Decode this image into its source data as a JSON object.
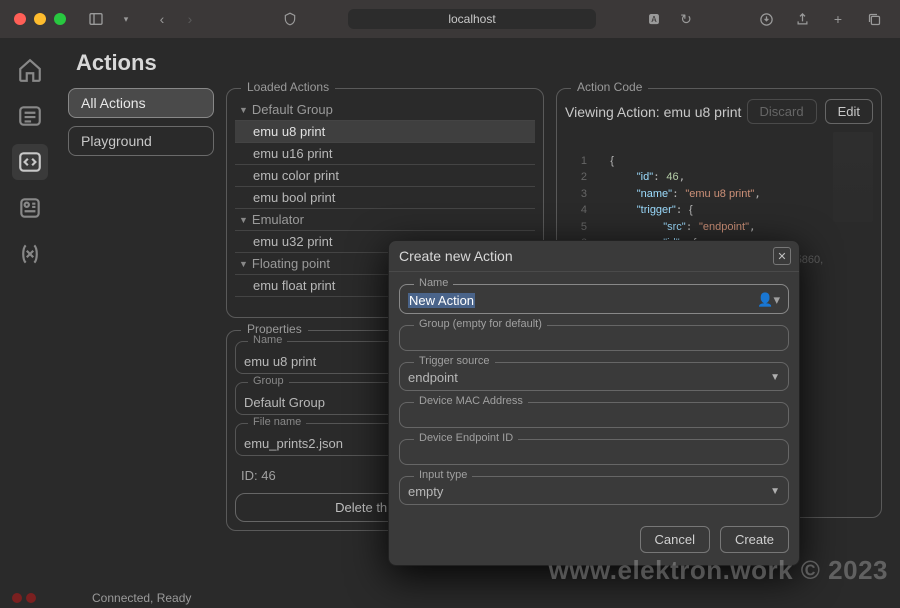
{
  "titlebar": {
    "address": "localhost"
  },
  "page": {
    "title": "Actions"
  },
  "sidebar_pills": {
    "all_actions": "All Actions",
    "playground": "Playground"
  },
  "loaded_actions": {
    "legend": "Loaded Actions",
    "groups": [
      {
        "name": "Default Group",
        "items": [
          "emu u8 print",
          "emu u16 print",
          "emu color print",
          "emu bool print"
        ]
      },
      {
        "name": "Emulator",
        "items": [
          "emu u32 print"
        ]
      },
      {
        "name": "Floating point",
        "items": [
          "emu float print"
        ]
      }
    ],
    "selected": "emu u8 print"
  },
  "properties": {
    "legend": "Properties",
    "name": {
      "label": "Name",
      "value": "emu u8 print"
    },
    "group": {
      "label": "Group",
      "value": "Default Group"
    },
    "file": {
      "label": "File name",
      "value": "emu_prints2.json"
    },
    "id_line": "ID: 46",
    "delete_label": "Delete this action"
  },
  "action_code": {
    "legend": "Action Code",
    "viewing_prefix": "Viewing Action: ",
    "viewing_name": "emu u8 print",
    "discard": "Discard",
    "edit": "Edit",
    "code": {
      "id": 46,
      "name": "emu u8 print",
      "trigger_src": "endpoint",
      "trailing_fragment": "5860,"
    }
  },
  "modal": {
    "title": "Create new Action",
    "fields": {
      "name": {
        "label": "Name",
        "value": "New Action"
      },
      "group": {
        "label": "Group (empty for default)",
        "value": ""
      },
      "trigger": {
        "label": "Trigger source",
        "value": "endpoint"
      },
      "mac": {
        "label": "Device MAC Address",
        "value": ""
      },
      "endpoint_id": {
        "label": "Device Endpoint ID",
        "value": ""
      },
      "input_type": {
        "label": "Input type",
        "value": "empty"
      }
    },
    "cancel": "Cancel",
    "create": "Create"
  },
  "statusbar": {
    "text": "Connected, Ready"
  },
  "watermark": "www.elektron.work © 2023"
}
